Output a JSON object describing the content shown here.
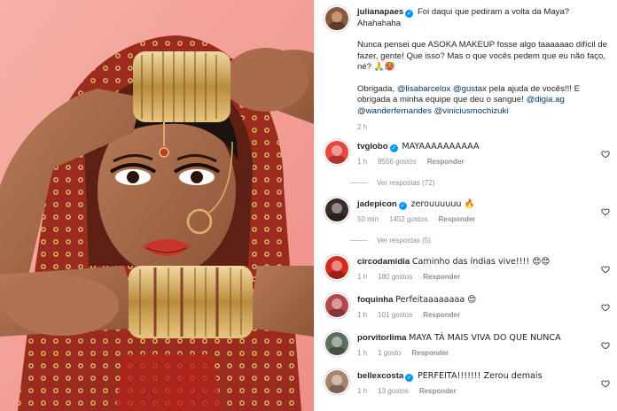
{
  "post": {
    "author": "julianapaes",
    "caption_line1": "Foi daqui que pediram a volta da Maya? Ahahahaha",
    "caption_line2": "Nunca pensei que ASOKA MAKEUP fosse algo taaaaaao difícil de fazer, gente! Que isso? Mas o que vocês pedem que eu não faço, né? 🙏🥵",
    "caption_line3_pre": "Obrigada,",
    "mention_1": "@lisabarcelox",
    "mention_2": "@gustax",
    "caption_line3_mid": "pela ajuda de vocês!!! E obrigada a minha equipe que deu o sangue!",
    "mention_3": "@digia.ag",
    "mention_4": "@wanderfernandes",
    "mention_5": "@viniciusmochizuki",
    "time": "2 h"
  },
  "comments": [
    {
      "user": "tvglobo",
      "verified": true,
      "text": "MAYAAAAAAAAAA",
      "time": "1 h",
      "likes": "8556 gostos",
      "reply": "Responder",
      "view_replies": "Ver respostas (72)",
      "avatar_color": "#e8463c"
    },
    {
      "user": "jadepicon",
      "verified": true,
      "text": "zerouuuuuu 🔥",
      "time": "50 min",
      "likes": "1452 gostos",
      "reply": "Responder",
      "view_replies": "Ver respostas (5)",
      "avatar_color": "#3a2a28"
    },
    {
      "user": "circodamidia",
      "verified": false,
      "text": "Caminho das índias vive!!!! 😍😍",
      "time": "1 h",
      "likes": "180 gostos",
      "reply": "Responder",
      "avatar_color": "#d42a1f"
    },
    {
      "user": "foquinha",
      "verified": false,
      "text": "Perfeitaaaaaaaa 😍",
      "time": "1 h",
      "likes": "101 gostos",
      "reply": "Responder",
      "avatar_color": "#b5474a"
    },
    {
      "user": "porvitorlima",
      "verified": false,
      "text": "MAYA TÁ MAIS VIVA DO QUE NUNCA",
      "time": "1 h",
      "likes": "1 gosto",
      "reply": "Responder",
      "avatar_color": "#5b6f5a"
    },
    {
      "user": "bellexcosta",
      "verified": true,
      "text": "PERFEITA!!!!!!! Zerou demais",
      "time": "1 h",
      "likes": "13 gostos",
      "reply": "Responder",
      "avatar_color": "#a98270"
    }
  ],
  "colors": {
    "background": "#f4a39a",
    "verified": "#0095f6",
    "mention": "#00376b",
    "muted": "#8e8e8e"
  },
  "icons": {
    "like": "heart-outline-icon",
    "verified": "verified-badge-icon"
  }
}
